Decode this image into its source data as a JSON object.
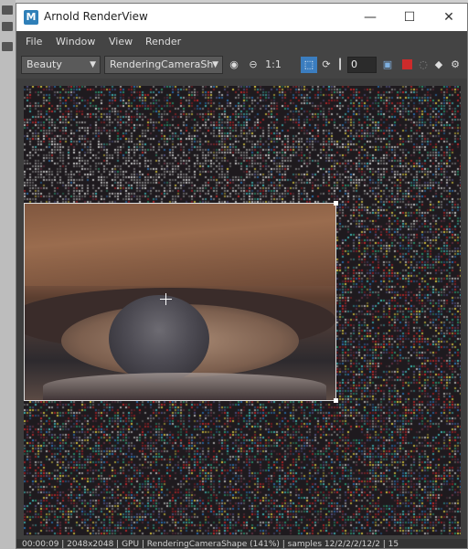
{
  "window": {
    "title": "Arnold RenderView",
    "minimize_icon": "minimize-icon",
    "maximize_icon": "maximize-icon",
    "close_icon": "close-icon"
  },
  "menubar": [
    "File",
    "Window",
    "View",
    "Render"
  ],
  "toolbar": {
    "aov_combo": "Beauty",
    "camera_combo": "RenderingCameraSh",
    "one_to_one": "1:1",
    "exposure_value": "0",
    "icons": [
      "display-icon",
      "sphere-icon",
      "crop-region-icon",
      "refresh-icon",
      "exposure-slider-icon",
      "snapshot-icon",
      "stop-icon",
      "progressive-icon",
      "debug-shading-icon",
      "settings-icon"
    ]
  },
  "colors": {
    "accent": "#3b7dbf",
    "stop": "#cc2b2b"
  },
  "status": {
    "text": "00:00:09 | 2048x2048 | GPU | RenderingCameraShape (141%) | samples 12/2/2/2/12/2 | 15"
  }
}
